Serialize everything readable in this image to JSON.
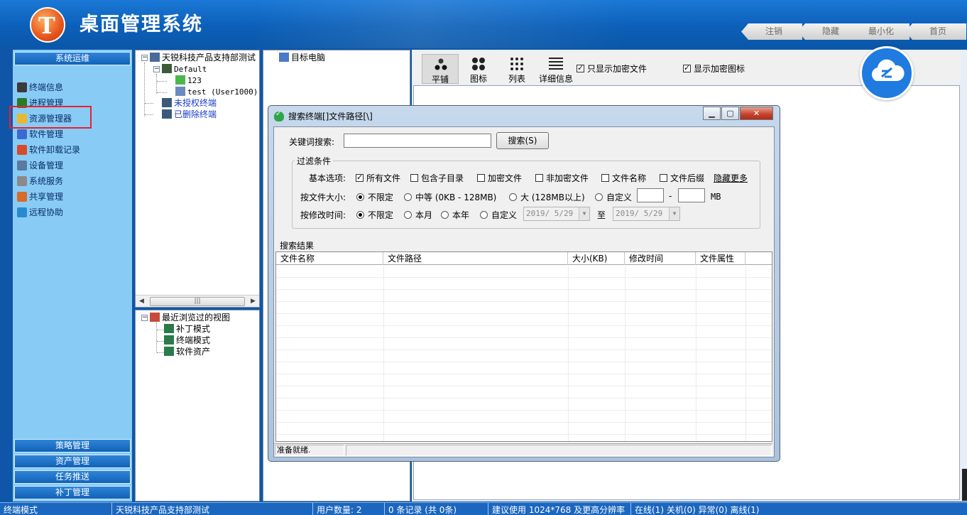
{
  "app": {
    "title": "桌面管理系统",
    "logo_letter": "T",
    "top_buttons": [
      "注销",
      "隐藏",
      "最小化",
      "首页"
    ]
  },
  "leftnav": {
    "section_title": "系统运维",
    "items": [
      {
        "label": "终端信息",
        "icon": "terminal-icon",
        "color": "#3a3a3a"
      },
      {
        "label": "进程管理",
        "icon": "process-icon",
        "color": "#2a7a2a"
      },
      {
        "label": "资源管理器",
        "icon": "folder-icon",
        "color": "#e8b830"
      },
      {
        "label": "软件管理",
        "icon": "software-icon",
        "color": "#3a6ad0"
      },
      {
        "label": "软件卸载记录",
        "icon": "uninstall-icon",
        "color": "#d84a2a"
      },
      {
        "label": "设备管理",
        "icon": "device-icon",
        "color": "#5a7aa0"
      },
      {
        "label": "系统服务",
        "icon": "service-icon",
        "color": "#8a8a8a"
      },
      {
        "label": "共享管理",
        "icon": "share-icon",
        "color": "#d86a2a"
      },
      {
        "label": "远程协助",
        "icon": "remote-icon",
        "color": "#2a8ad0"
      }
    ],
    "bottom_sections": [
      "策略管理",
      "资产管理",
      "任务推送",
      "补丁管理"
    ]
  },
  "tree": {
    "root": "天锐科技产品支持部测试",
    "group": "Default",
    "machines": [
      "123",
      "test (User1000)"
    ],
    "unauthorized": "未授权终端",
    "deleted": "已删除终端"
  },
  "recent": {
    "root": "最近浏览过的视图",
    "items": [
      "补丁模式",
      "终端模式",
      "软件资产"
    ]
  },
  "target": {
    "label": "目标电脑"
  },
  "toolbar": {
    "views": [
      "平铺",
      "图标",
      "列表",
      "详细信息"
    ],
    "active_view": "平铺",
    "only_encrypted_label": "只显示加密文件",
    "only_encrypted_checked": true,
    "show_encrypted_icon_label": "显示加密图标",
    "show_encrypted_icon_checked": true
  },
  "dialog": {
    "title": "搜索终端[]文件路径[\\]",
    "keyword_label": "关键词搜索:",
    "keyword_value": "",
    "search_button": "搜索(S)",
    "filter_group": "过滤条件",
    "basic_label": "基本选项:",
    "basic_options": [
      {
        "label": "所有文件",
        "checked": true
      },
      {
        "label": "包含子目录",
        "checked": false
      },
      {
        "label": "加密文件",
        "checked": false
      },
      {
        "label": "非加密文件",
        "checked": false
      },
      {
        "label": "文件名称",
        "checked": false
      },
      {
        "label": "文件后缀",
        "checked": false
      }
    ],
    "hide_more": "隐藏更多",
    "size_label": "按文件大小:",
    "size_options": [
      {
        "label": "不限定",
        "selected": true
      },
      {
        "label": "中等 (0KB - 128MB)",
        "selected": false
      },
      {
        "label": "大 (128MB以上)",
        "selected": false
      },
      {
        "label": "自定义",
        "selected": false
      }
    ],
    "size_dash": "-",
    "size_unit": "MB",
    "time_label": "按修改时间:",
    "time_options": [
      {
        "label": "不限定",
        "selected": true
      },
      {
        "label": "本月",
        "selected": false
      },
      {
        "label": "本年",
        "selected": false
      },
      {
        "label": "自定义",
        "selected": false
      }
    ],
    "date_from": "2019/ 5/29",
    "date_to_label": "至",
    "date_to": "2019/ 5/29",
    "results_label": "搜索结果",
    "columns": [
      "文件名称",
      "文件路径",
      "大小(KB)",
      "修改时间",
      "文件属性"
    ],
    "rows": [],
    "status": "准备就绪."
  },
  "statusbar": {
    "mode": "终端模式",
    "org": "天锐科技产品支持部测试",
    "users": "用户数量: 2",
    "records": "0 条记录 (共 0条)",
    "resolution": "建议使用 1024*768 及更高分辨率",
    "online": "在线(1) 关机(0) 异常(0) 离线(1)"
  }
}
